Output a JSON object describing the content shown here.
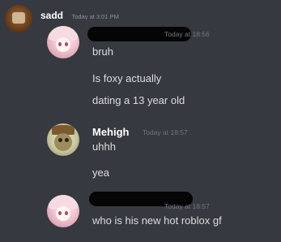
{
  "outer": {
    "username": "sadd",
    "timestamp": "Today at 3:01 PM",
    "avatar_icon": "brown-avatar-icon"
  },
  "screenshot": {
    "messages": [
      {
        "author": "",
        "author_redacted": true,
        "timestamp": "Today at 18:56",
        "avatar_icon": "pink-anime-avatar-icon",
        "lines": [
          "bruh",
          "Is foxy actually",
          "dating a 13 year old"
        ]
      },
      {
        "author": "Mehigh",
        "author_redacted": false,
        "timestamp": "Today at 18:57",
        "avatar_icon": "cartoon-avatar-icon",
        "lines": [
          "uhhh",
          "yea"
        ]
      },
      {
        "author": "",
        "author_redacted": true,
        "timestamp": "Today at 18:57",
        "avatar_icon": "pink-anime-avatar-icon",
        "lines": [
          "who is his new hot roblox gf"
        ]
      }
    ]
  },
  "colors": {
    "background": "#36393f",
    "username": "#ffffff",
    "text": "#dcddde",
    "timestamp": "#72767d",
    "redaction": "#050505"
  }
}
